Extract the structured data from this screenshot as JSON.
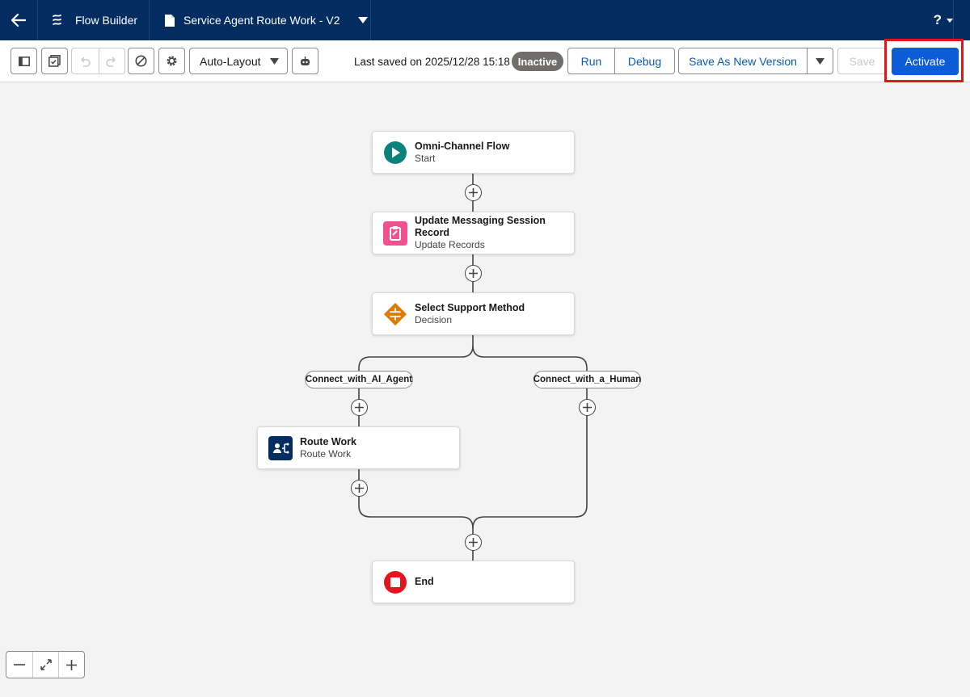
{
  "header": {
    "app_name": "Flow Builder",
    "flow_name": "Service Agent Route Work - V2",
    "help_label": "?"
  },
  "toolbar": {
    "layout_mode": "Auto-Layout",
    "last_saved": "Last saved on 2025/12/28 15:18",
    "status": "Inactive",
    "run_label": "Run",
    "debug_label": "Debug",
    "save_as_new_label": "Save As New Version",
    "save_label": "Save",
    "activate_label": "Activate"
  },
  "nodes": {
    "start": {
      "title": "Omni-Channel Flow",
      "subtitle": "Start"
    },
    "update": {
      "title": "Update Messaging Session Record",
      "subtitle": "Update Records"
    },
    "decision": {
      "title": "Select Support Method",
      "subtitle": "Decision"
    },
    "route": {
      "title": "Route Work",
      "subtitle": "Route Work"
    },
    "end": {
      "title": "End"
    }
  },
  "branches": {
    "left": "Connect_with_AI_Agent",
    "right": "Connect_with_a_Human"
  },
  "colors": {
    "header_bg": "#032d60",
    "brand_blue": "#0b5cd7",
    "start_icon": "#0b827c",
    "update_icon": "#f0518f",
    "decision_icon": "#dd7a01",
    "route_icon": "#032d60",
    "end_icon": "#e3141c",
    "highlight": "#e3141c"
  }
}
